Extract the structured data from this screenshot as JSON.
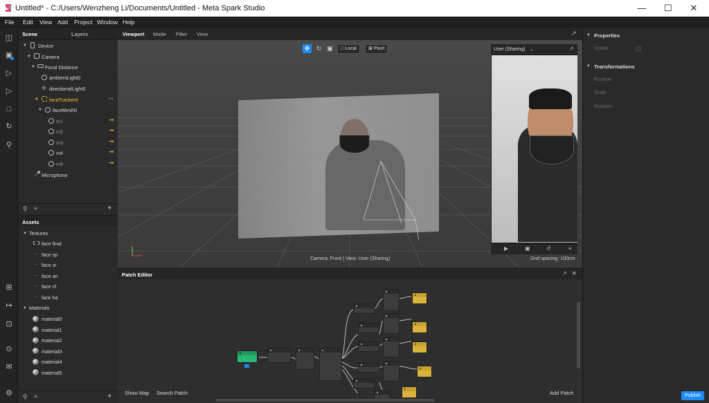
{
  "window": {
    "title": "Untitled* - C:/Users/Wenzheng Li/Documents/Untitled - Meta Spark Studio"
  },
  "menu": [
    "File",
    "Edit",
    "View",
    "Add",
    "Project",
    "Window",
    "Help"
  ],
  "left_toolbar": [
    "layout-icon",
    "camera-add-icon",
    "play-icon",
    "step-icon",
    "stop-icon",
    "refresh-icon",
    "search-icon",
    "import-icon",
    "export-icon",
    "upload-icon",
    "settings-icon",
    "feedback-icon",
    "gear-icon"
  ],
  "scene_panel": {
    "tabs": [
      "Scene",
      "Layers"
    ],
    "tree": [
      "Device",
      "Camera",
      "Focal Distance",
      "ambientLight0",
      "directionalLight0",
      "faceTracker0",
      "faceMesh0",
      "m1",
      "m2",
      "m3",
      "m4",
      "m5",
      "Microphone"
    ]
  },
  "assets_panel": {
    "title": "Assets",
    "textures_label": "Textures",
    "textures": [
      "face final",
      "face sp",
      "face sr",
      "face an",
      "face cf",
      "face ha"
    ],
    "materials_label": "Materials",
    "materials": [
      "material0",
      "material1",
      "material2",
      "material3",
      "material4",
      "material5"
    ]
  },
  "viewport": {
    "tabs": [
      "Viewport",
      "Mode",
      "Filter",
      "View"
    ],
    "local_label": "Local",
    "pivot_label": "Pivot",
    "status": "Camera: Front | View: User (Sharing)",
    "grid_spacing": "Grid spacing: 100cm",
    "preview_device": "User (Sharing)"
  },
  "patch_editor": {
    "title": "Patch Editor",
    "show_map": "Show Map",
    "search_patch": "Search Patch",
    "add_patch": "Add Patch"
  },
  "properties": {
    "title": "Properties",
    "visible": "Visible",
    "transformations": "Transformations",
    "position": "Position",
    "scale": "Scale",
    "rotation": "Rotation"
  },
  "publish_label": "Publish",
  "colors": {
    "accent": "#1e8bf5",
    "selected": "#f0c030",
    "patch_yellow": "#d9b33c",
    "patch_green": "#2bb673"
  }
}
